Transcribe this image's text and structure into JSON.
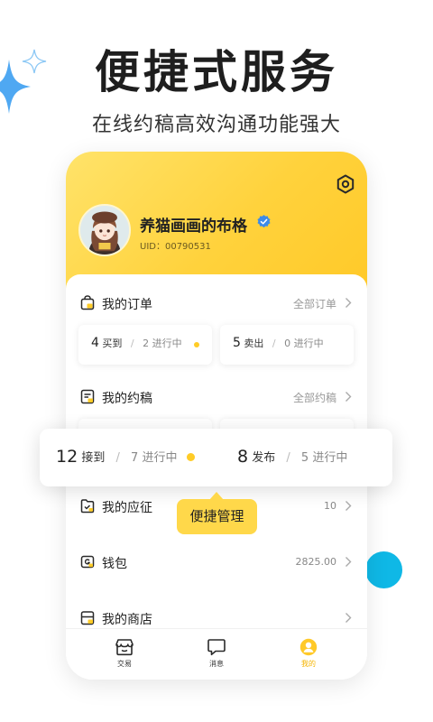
{
  "promo": {
    "title": "便捷式服务",
    "subtitle": "在线约稿高效沟通功能强大"
  },
  "profile": {
    "username": "养猫画画的布格",
    "uid": "UID：00790531"
  },
  "orders": {
    "label": "我的订单",
    "link": "全部订单",
    "bought_count": "4",
    "bought_label": "买到",
    "bought_active": "2 进行中",
    "sold_count": "5",
    "sold_label": "卖出",
    "sold_active": "0 进行中"
  },
  "commissions": {
    "label": "我的约稿",
    "link": "全部约稿"
  },
  "floating_card": {
    "received_count": "12",
    "received_label": "接到",
    "received_active_num": "7",
    "received_active_label": "进行中",
    "posted_count": "8",
    "posted_label": "发布",
    "posted_active_num": "5",
    "posted_active_label": "进行中"
  },
  "applications": {
    "label": "我的应征",
    "value": "10"
  },
  "tooltip": {
    "text": "便捷管理"
  },
  "wallet": {
    "label": "钱包",
    "value": "2825.00"
  },
  "shop": {
    "label": "我的商店"
  },
  "tabbar": {
    "items": [
      {
        "label": "交易",
        "icon": "shop-icon"
      },
      {
        "label": "消息",
        "icon": "chat-icon"
      },
      {
        "label": "我的",
        "icon": "profile-icon",
        "active": true
      }
    ]
  },
  "colors": {
    "brand_yellow": "#ffd23c",
    "accent_dot": "#ffcc27",
    "accent_blue": "#0fb8e6",
    "verified_blue": "#3d8be8"
  }
}
